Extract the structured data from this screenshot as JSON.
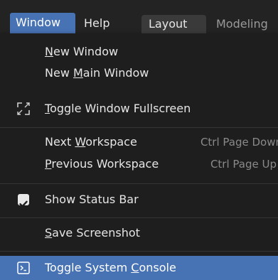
{
  "menubar": {
    "window_label": "Window",
    "help_label": "Help",
    "workspace_tabs": [
      "Layout",
      "Modeling"
    ]
  },
  "window_menu": {
    "items": [
      {
        "pre": "",
        "u": "N",
        "post": "ew Window",
        "shortcut": ""
      },
      {
        "pre": "New ",
        "u": "M",
        "post": "ain Window",
        "shortcut": ""
      },
      {
        "pre": "",
        "u": "T",
        "post": "oggle Window Fullscreen",
        "shortcut": "",
        "icon": "fullscreen-icon"
      },
      {
        "pre": "Next ",
        "u": "W",
        "post": "orkspace",
        "shortcut": "Ctrl Page Down"
      },
      {
        "pre": "",
        "u": "P",
        "post": "revious Workspace",
        "shortcut": "Ctrl Page Up"
      },
      {
        "pre": "Show Status Bar",
        "u": "",
        "post": "",
        "shortcut": "",
        "checked": true
      },
      {
        "pre": "",
        "u": "S",
        "post": "ave Screenshot",
        "shortcut": ""
      },
      {
        "pre": "Toggle System ",
        "u": "C",
        "post": "onsole",
        "shortcut": "",
        "icon": "console-icon",
        "highlighted": true
      }
    ]
  },
  "colors": {
    "accent": "#4772b3",
    "menu_bg": "#1e1e1e",
    "topbar_bg": "#232323"
  }
}
